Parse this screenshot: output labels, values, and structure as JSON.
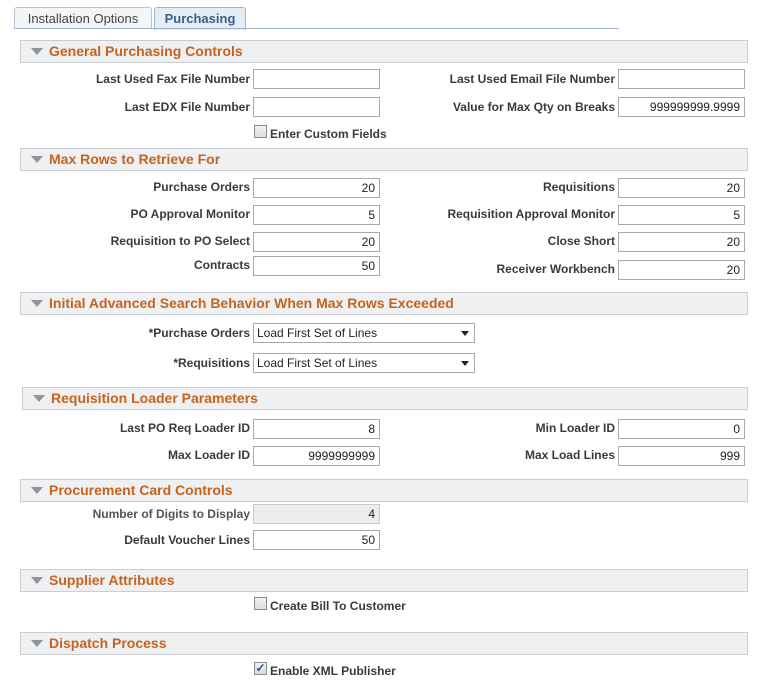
{
  "tabs": {
    "installation_options": "Installation Options",
    "purchasing": "Purchasing"
  },
  "general_purchasing_controls": {
    "header": "General Purchasing Controls",
    "last_fax_label": "Last Used Fax File Number",
    "last_fax_value": "",
    "last_email_label": "Last Used Email File Number",
    "last_email_value": "",
    "last_edx_label": "Last EDX File Number",
    "last_edx_value": "",
    "max_qty_label": "Value for Max Qty on Breaks",
    "max_qty_value": "999999999.9999",
    "custom_fields_label": "Enter Custom Fields",
    "custom_fields_checked": false
  },
  "max_rows": {
    "header": "Max Rows to Retrieve For",
    "purchase_orders_label": "Purchase Orders",
    "purchase_orders_value": "20",
    "requisitions_label": "Requisitions",
    "requisitions_value": "20",
    "po_approval_label": "PO Approval Monitor",
    "po_approval_value": "5",
    "req_approval_label": "Requisition Approval Monitor",
    "req_approval_value": "5",
    "req_to_po_label": "Requisition to PO Select",
    "req_to_po_value": "20",
    "close_short_label": "Close Short",
    "close_short_value": "20",
    "contracts_label": "Contracts",
    "contracts_value": "50",
    "receiver_wb_label": "Receiver Workbench",
    "receiver_wb_value": "20"
  },
  "advanced_search": {
    "header": "Initial Advanced Search Behavior When Max Rows Exceeded",
    "purchase_orders_label": "*Purchase Orders",
    "purchase_orders_value": "Load First Set of Lines",
    "requisitions_label": "*Requisitions",
    "requisitions_value": "Load First Set of Lines"
  },
  "req_loader": {
    "header": "Requisition Loader Parameters",
    "last_po_req_label": "Last PO Req Loader ID",
    "last_po_req_value": "8",
    "min_loader_label": "Min Loader ID",
    "min_loader_value": "0",
    "max_loader_label": "Max Loader ID",
    "max_loader_value": "9999999999",
    "max_load_lines_label": "Max Load Lines",
    "max_load_lines_value": "999"
  },
  "procurement_card": {
    "header": "Procurement Card Controls",
    "digits_label": "Number of Digits to Display",
    "digits_value": "4",
    "voucher_lines_label": "Default Voucher Lines",
    "voucher_lines_value": "50"
  },
  "supplier_attributes": {
    "header": "Supplier Attributes",
    "bill_to_label": "Create Bill To Customer",
    "bill_to_checked": false
  },
  "dispatch": {
    "header": "Dispatch Process",
    "xml_label": "Enable XML Publisher",
    "xml_checked": true
  }
}
